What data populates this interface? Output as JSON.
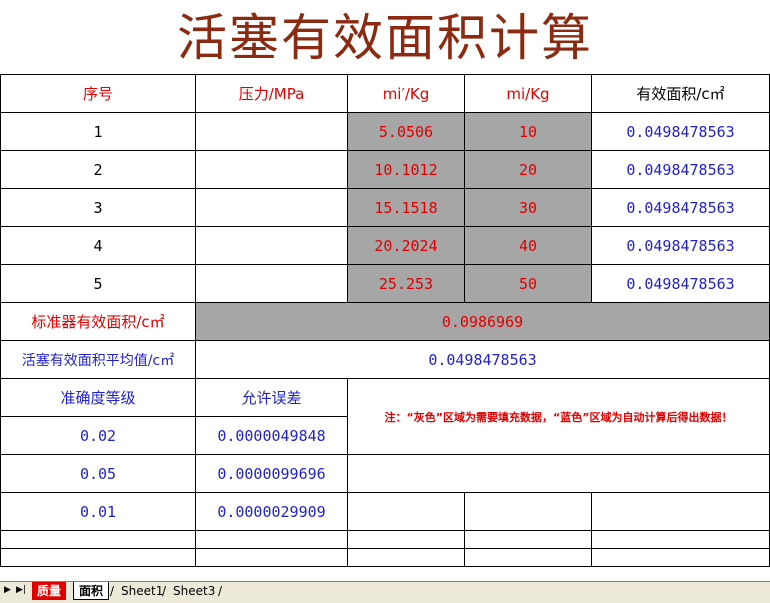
{
  "title": "活塞有效面积计算",
  "headers": [
    "序号",
    "压力/MPa",
    "mi′/Kg",
    "mi/Kg",
    "有效面积/c㎡"
  ],
  "rows": [
    {
      "no": "1",
      "pressure": "",
      "mi_prime": "5.0506",
      "mi": "10",
      "area": "0.0498478563"
    },
    {
      "no": "2",
      "pressure": "",
      "mi_prime": "10.1012",
      "mi": "20",
      "area": "0.0498478563"
    },
    {
      "no": "3",
      "pressure": "",
      "mi_prime": "15.1518",
      "mi": "30",
      "area": "0.0498478563"
    },
    {
      "no": "4",
      "pressure": "",
      "mi_prime": "20.2024",
      "mi": "40",
      "area": "0.0498478563"
    },
    {
      "no": "5",
      "pressure": "",
      "mi_prime": "25.253",
      "mi": "50",
      "area": "0.0498478563"
    }
  ],
  "standard": {
    "label": "标准器有效面积/c㎡",
    "value": "0.0986969"
  },
  "average": {
    "label": "活塞有效面积平均值/c㎡",
    "value": "0.0498478563"
  },
  "accuracy": {
    "header_grade": "准确度等级",
    "header_error": "允许误差",
    "rows": [
      {
        "grade": "0.02",
        "error": "0.0000049848"
      },
      {
        "grade": "0.05",
        "error": "0.0000099696"
      },
      {
        "grade": "0.01",
        "error": "0.0000029909"
      }
    ]
  },
  "note": "注：“灰色”区域为需要填充数据，“蓝色”区域为自动计算后得出数据！",
  "sheet_tabs": [
    "质量",
    "面积",
    "Sheet1",
    "Sheet3"
  ],
  "active_tab": "面积",
  "colors": {
    "title": "#8b2a10",
    "red_text": "#e00000",
    "blue_text": "#2222cc",
    "input_fill": "#a6a6a6"
  }
}
